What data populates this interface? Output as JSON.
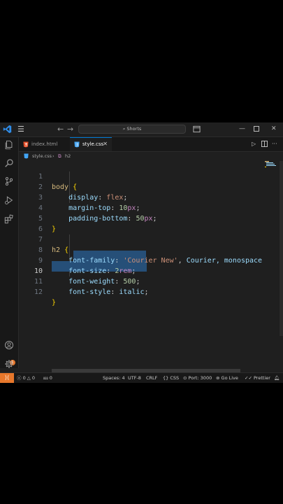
{
  "titlebar": {
    "search_text": "⌕ Shorts",
    "back_icon": "arrow-left-icon",
    "forward_icon": "arrow-right-icon"
  },
  "tabs": [
    {
      "label": "index.html",
      "icon": "html5-icon",
      "color": "#e44d26"
    },
    {
      "label": "style.css",
      "icon": "css3-icon",
      "color": "#42a5f5",
      "active": true
    }
  ],
  "breadcrumb": {
    "file": "style.css",
    "symbol": "h2"
  },
  "editor": {
    "lines": [
      {
        "n": "1"
      },
      {
        "n": "2"
      },
      {
        "n": "3"
      },
      {
        "n": "4"
      },
      {
        "n": "5"
      },
      {
        "n": "6"
      },
      {
        "n": "7"
      },
      {
        "n": "8"
      },
      {
        "n": "9"
      },
      {
        "n": "10"
      },
      {
        "n": "11"
      },
      {
        "n": "12"
      }
    ],
    "code": {
      "l1_sel": "body",
      "l1_brace": "{",
      "l2_prop": "display",
      "l2_val": "flex",
      "l3_prop": "margin-top",
      "l3_num": "10",
      "l3_unit": "px",
      "l4_prop": "padding-bottom",
      "l4_num": "50",
      "l4_unit": "px",
      "l5": "}",
      "l7_sel": "h2",
      "l7_brace": "{",
      "l8_prop": "font-family",
      "l8_str": "'Courier New'",
      "l8_rest": "Courier, monospace",
      "l9_prop": "font-size",
      "l9_num": "2",
      "l9_unit": "rem",
      "l10_prop": "font-weight",
      "l10_num": "500",
      "l11_prop": "font-style",
      "l11_val": "italic",
      "l12": "}"
    }
  },
  "statusbar": {
    "errors": "0",
    "warnings": "0",
    "ports": "0",
    "spaces": "Spaces: 4",
    "encoding": "UTF-8",
    "eol": "CRLF",
    "language": "CSS",
    "port": "Port: 3000",
    "golive": "Go Live",
    "prettier": "Prettier"
  },
  "colors": {
    "accent": "#0078d4",
    "remote": "#e7772b"
  }
}
